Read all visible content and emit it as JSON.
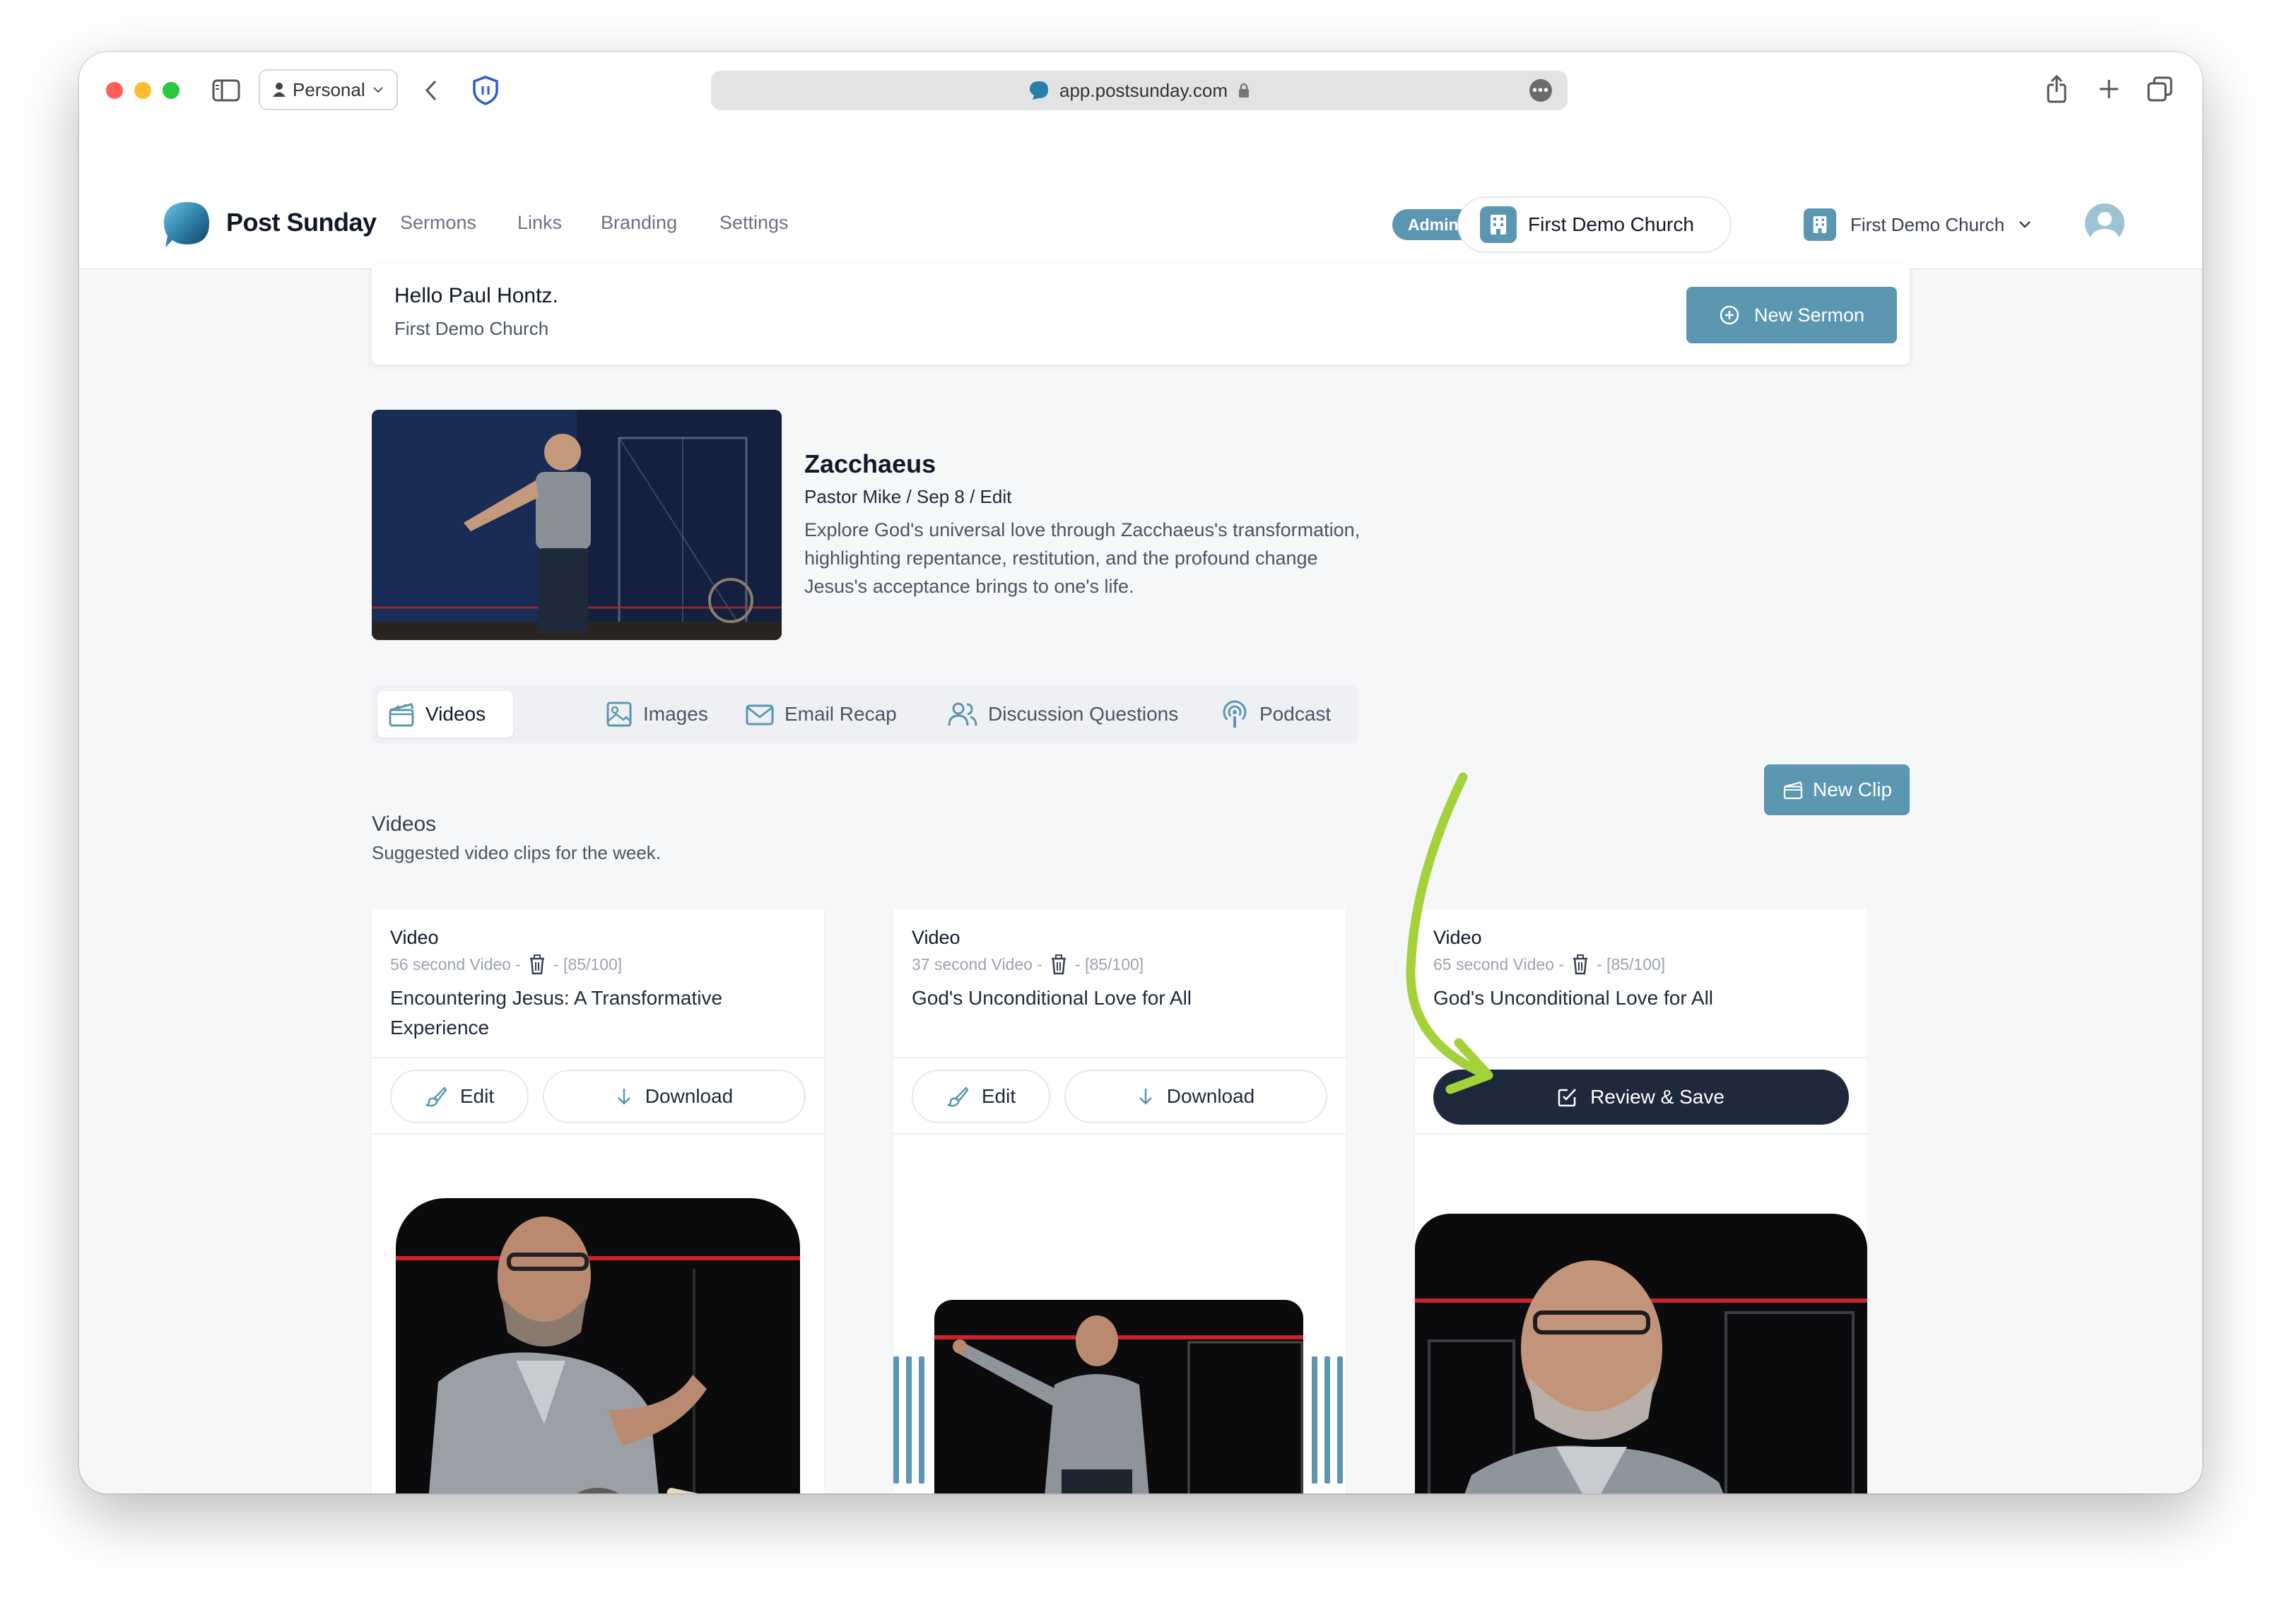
{
  "browser": {
    "profile": "Personal",
    "url": "app.postsunday.com"
  },
  "app": {
    "name": "Post Sunday",
    "nav": [
      "Sermons",
      "Links",
      "Branding",
      "Settings"
    ],
    "admin_badge": "Admin",
    "church_pill": "First Demo Church",
    "church_select": "First Demo Church"
  },
  "greeting": {
    "title": "Hello Paul Hontz.",
    "subtitle": "First Demo Church",
    "new_sermon_label": "New Sermon"
  },
  "sermon": {
    "title": "Zacchaeus",
    "meta": "Pastor Mike / Sep 8 / Edit",
    "description": "Explore God's universal love through Zacchaeus's transformation, highlighting repentance, restitution, and the profound change Jesus's acceptance brings to one's life."
  },
  "tabs": [
    {
      "label": "Videos",
      "icon": "clapperboard-icon",
      "active": true
    },
    {
      "label": "Images",
      "icon": "image-icon",
      "active": false
    },
    {
      "label": "Email Recap",
      "icon": "mail-icon",
      "active": false
    },
    {
      "label": "Discussion Questions",
      "icon": "users-icon",
      "active": false
    },
    {
      "label": "Podcast",
      "icon": "podcast-icon",
      "active": false
    }
  ],
  "videos_section": {
    "title": "Videos",
    "subtitle": "Suggested video clips for the week.",
    "new_clip_label": "New Clip"
  },
  "clips": [
    {
      "label": "Video",
      "duration": "56 second Video -",
      "score": "- [85/100]",
      "title": "Encountering Jesus: A Transformative Experience",
      "edit_label": "Edit",
      "download_label": "Download"
    },
    {
      "label": "Video",
      "duration": "37 second Video -",
      "score": "- [85/100]",
      "title": "God's Unconditional Love for All",
      "edit_label": "Edit",
      "download_label": "Download"
    },
    {
      "label": "Video",
      "duration": "65 second Video -",
      "score": "- [85/100]",
      "title": "God's Unconditional Love for All",
      "review_label": "Review & Save"
    }
  ],
  "colors": {
    "accent": "#5b97b1",
    "dark_button": "#1e293b",
    "annotation_arrow": "#a4d23b",
    "stage_red": "#c7242b"
  }
}
